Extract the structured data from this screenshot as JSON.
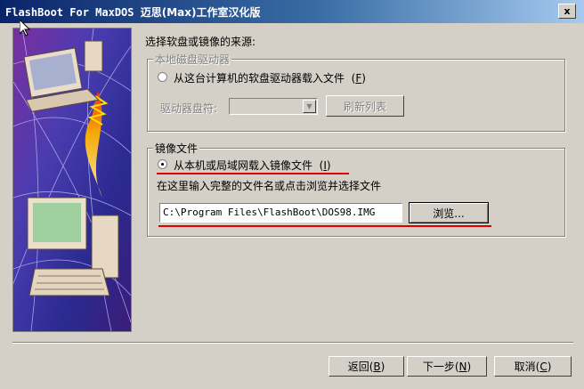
{
  "window": {
    "title_prefix": "FlashBoot For MaxDOS",
    "title_suffix": "迈思(Max)工作室汉化版",
    "close_glyph": "x"
  },
  "source_heading": "选择软盘或镜像的来源:",
  "local_group": {
    "legend": "本地磁盘驱动器",
    "radio_label": "从这台计算机的软盘驱动器载入文件",
    "radio_hotkey": "F",
    "radio_checked": false,
    "drive_label": "驱动器盘符:",
    "drive_value": "",
    "refresh_button": "刷新列表",
    "enabled": false
  },
  "image_group": {
    "legend": "镜像文件",
    "radio_label": "从本机或局域网载入镜像文件",
    "radio_hotkey": "I",
    "radio_checked": true,
    "hint": "在这里输入完整的文件名或点击浏览并选择文件",
    "path_value": "C:\\Program Files\\FlashBoot\\DOS98.IMG",
    "browse_button": "浏览..."
  },
  "footer": {
    "back_label": "返回",
    "back_hotkey": "B",
    "next_label": "下一步",
    "next_hotkey": "N",
    "cancel_label": "取消",
    "cancel_hotkey": "C"
  },
  "colors": {
    "title_gradient_start": "#0a246a",
    "title_gradient_end": "#a6caf0",
    "annotation_red": "#e00000",
    "dialog_face": "#d4d0c8"
  }
}
